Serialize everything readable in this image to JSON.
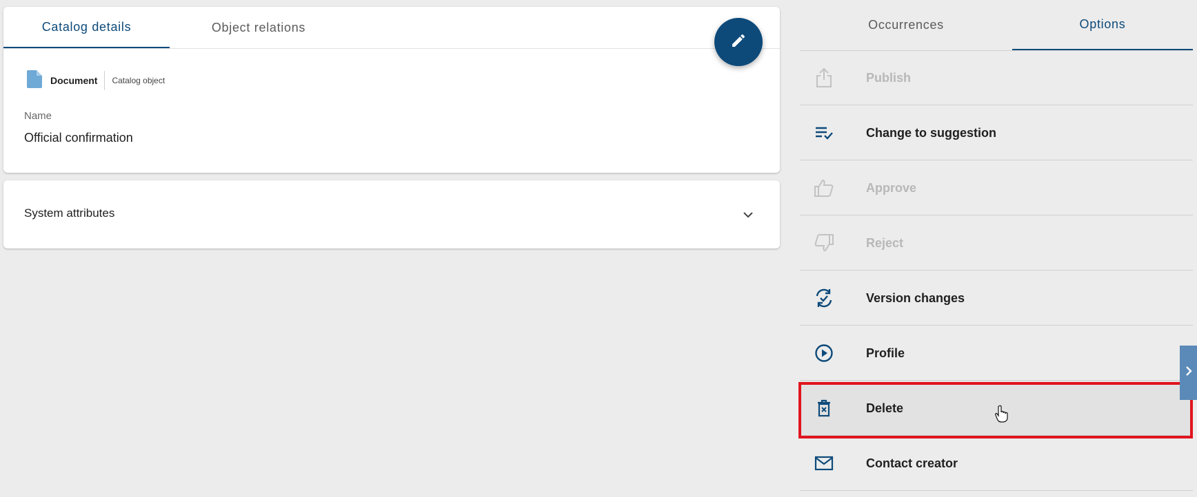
{
  "left_tabs": [
    {
      "label": "Catalog details",
      "active": true
    },
    {
      "label": "Object relations",
      "active": false
    }
  ],
  "object": {
    "type": "Document",
    "kind": "Catalog object",
    "name_label": "Name",
    "name_value": "Official confirmation"
  },
  "system_section": {
    "title": "System attributes"
  },
  "right_tabs": [
    {
      "label": "Occurrences",
      "active": false
    },
    {
      "label": "Options",
      "active": true
    }
  ],
  "options": [
    {
      "label": "Publish",
      "icon": "publish-icon",
      "disabled": true
    },
    {
      "label": "Change to suggestion",
      "icon": "playlist-check-icon",
      "disabled": false
    },
    {
      "label": "Approve",
      "icon": "thumb-up-icon",
      "disabled": true
    },
    {
      "label": "Reject",
      "icon": "thumb-down-icon",
      "disabled": true
    },
    {
      "label": "Version changes",
      "icon": "sync-check-icon",
      "disabled": false
    },
    {
      "label": "Profile",
      "icon": "play-circle-icon",
      "disabled": false
    },
    {
      "label": "Delete",
      "icon": "trash-icon",
      "disabled": false,
      "highlighted": true
    },
    {
      "label": "Contact creator",
      "icon": "mail-icon",
      "disabled": false
    }
  ],
  "colors": {
    "accent": "#0d4a7a",
    "highlight": "#e0151f",
    "disabled_text": "#b8b8b8",
    "doc_icon": "#6fa9d6",
    "side_toggle": "#5b8ab8"
  }
}
